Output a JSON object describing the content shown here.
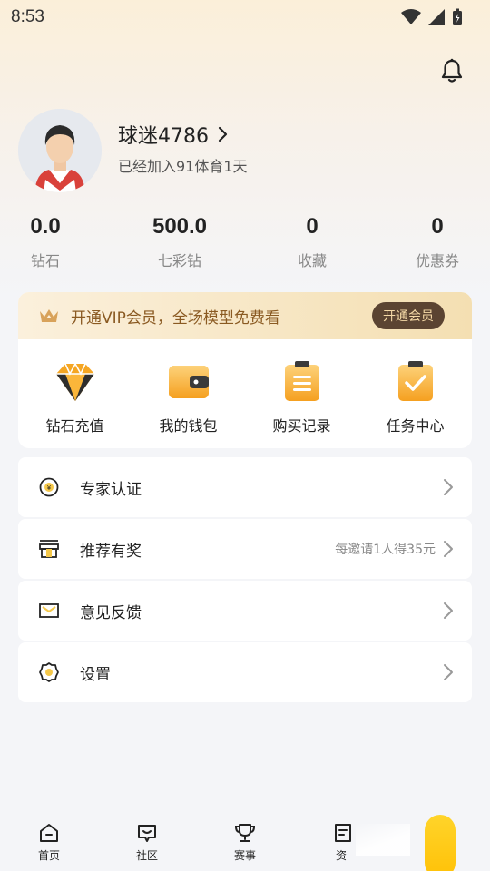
{
  "status_bar": {
    "time": "8:53"
  },
  "profile": {
    "username": "球迷4786",
    "join_text": "已经加入91体育1天"
  },
  "stats": [
    {
      "value": "0.0",
      "label": "钻石"
    },
    {
      "value": "500.0",
      "label": "七彩钻"
    },
    {
      "value": "0",
      "label": "收藏"
    },
    {
      "value": "0",
      "label": "优惠券"
    }
  ],
  "vip": {
    "text": "开通VIP会员，全场模型免费看",
    "button": "开通会员"
  },
  "quick_actions": [
    {
      "label": "钻石充值",
      "icon": "diamond-icon"
    },
    {
      "label": "我的钱包",
      "icon": "wallet-icon"
    },
    {
      "label": "购买记录",
      "icon": "clipboard-icon"
    },
    {
      "label": "任务中心",
      "icon": "task-check-icon"
    }
  ],
  "menu": [
    {
      "label": "专家认证",
      "icon": "coin-icon",
      "hint": ""
    },
    {
      "label": "推荐有奖",
      "icon": "gift-icon",
      "hint": "每邀请1人得35元"
    },
    {
      "label": "意见反馈",
      "icon": "mail-icon",
      "hint": ""
    },
    {
      "label": "设置",
      "icon": "settings-icon",
      "hint": ""
    }
  ],
  "tabbar": [
    {
      "label": "首页",
      "icon": "home-icon"
    },
    {
      "label": "社区",
      "icon": "chat-icon"
    },
    {
      "label": "赛事",
      "icon": "trophy-icon"
    },
    {
      "label": "资",
      "icon": "news-icon"
    }
  ],
  "colors": {
    "accent_gold": "#f5a623",
    "vip_text": "#8a5a22",
    "vip_button_bg": "#5b4432",
    "fab_yellow": "#ffcc1a"
  }
}
